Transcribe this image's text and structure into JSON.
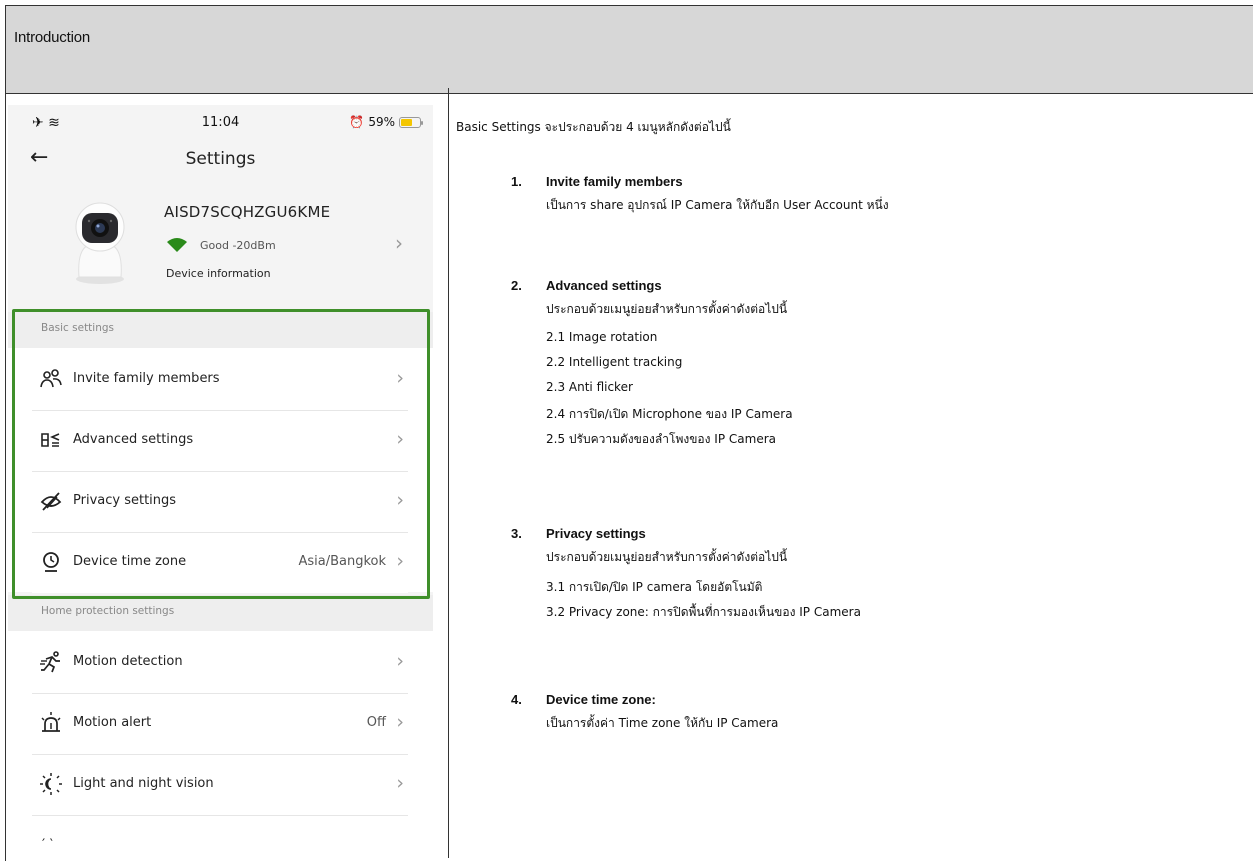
{
  "header": {
    "title": "Introduction"
  },
  "phone": {
    "status_bar": {
      "icons": "✈ ≋",
      "time": "11:04",
      "battery_text": "59%",
      "battery_level": 0.59,
      "alarm_icon": "alarm-icon"
    },
    "nav": {
      "title": "Settings",
      "back_icon": "back-arrow-icon"
    },
    "device": {
      "name": "AISD7SCQHZGU6KME",
      "signal": "Good -20dBm",
      "info": "Device information"
    },
    "basic_section": {
      "header": "Basic settings",
      "items": [
        {
          "label": "Invite family members",
          "value": "",
          "icon": "people-icon"
        },
        {
          "label": "Advanced settings",
          "value": "",
          "icon": "speaker-settings-icon"
        },
        {
          "label": "Privacy settings",
          "value": "",
          "icon": "eye-off-icon"
        },
        {
          "label": "Device time zone",
          "value": "Asia/Bangkok",
          "icon": "clock-pin-icon"
        }
      ]
    },
    "home_section": {
      "header": "Home protection settings",
      "items": [
        {
          "label": "Motion detection",
          "value": "",
          "icon": "running-icon"
        },
        {
          "label": "Motion alert",
          "value": "Off",
          "icon": "alarm-light-icon"
        },
        {
          "label": "Light and night vision",
          "value": "",
          "icon": "sun-moon-icon"
        }
      ]
    },
    "highlight_color": "#3f8f2a"
  },
  "content": {
    "intro": "Basic Settings จะประกอบด้วย 4 เมนูหลักดังต่อไปนี้",
    "items": [
      {
        "number": "1.",
        "title": "Invite family members",
        "description": "เป็นการ share อุปกรณ์ IP Camera ให้กับอีก User Account หนึ่ง",
        "sub": []
      },
      {
        "number": "2.",
        "title": "Advanced settings",
        "description": "ประกอบด้วยเมนูย่อยสำหรับการตั้งค่าดังต่อไปนี้",
        "sub": [
          "2.1 Image rotation",
          "2.2 Intelligent tracking",
          "2.3 Anti flicker",
          "2.4 การปิด/เปิด Microphone ของ IP Camera",
          "2.5 ปรับความดังของลำโพงของ IP Camera"
        ]
      },
      {
        "number": "3.",
        "title": "Privacy settings",
        "description": "ประกอบด้วยเมนูย่อยสำหรับการตั้งค่าดังต่อไปนี้",
        "sub": [
          "3.1 การเปิด/ปิด IP camera โดยอัตโนมัติ",
          "3.2 Privacy zone: การปิดพื้นที่การมองเห็นของ IP Camera"
        ]
      },
      {
        "number": "4.",
        "title": "Device time zone:",
        "description": "เป็นการตั้งค่า Time zone ให้กับ IP Camera",
        "sub": []
      }
    ]
  }
}
